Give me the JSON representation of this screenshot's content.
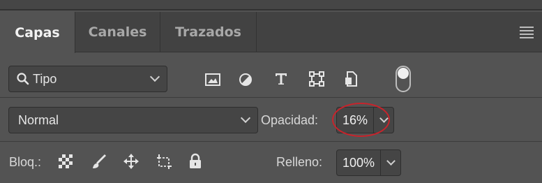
{
  "tabs": [
    {
      "label": "Capas",
      "active": true
    },
    {
      "label": "Canales",
      "active": false
    },
    {
      "label": "Trazados",
      "active": false
    }
  ],
  "filter": {
    "kind_label": "Tipo",
    "icons": [
      "image-filter-icon",
      "adjustment-filter-icon",
      "type-filter-icon",
      "shape-filter-icon",
      "smart-object-filter-icon"
    ]
  },
  "blend": {
    "mode": "Normal",
    "opacity_label": "Opacidad:",
    "opacity_value": "16%"
  },
  "lock": {
    "label": "Bloq.:",
    "fill_label": "Relleno:",
    "fill_value": "100%"
  },
  "colors": {
    "panel_bg": "#535353",
    "field_bg": "#454545",
    "highlight_ellipse": "#c8232b"
  }
}
